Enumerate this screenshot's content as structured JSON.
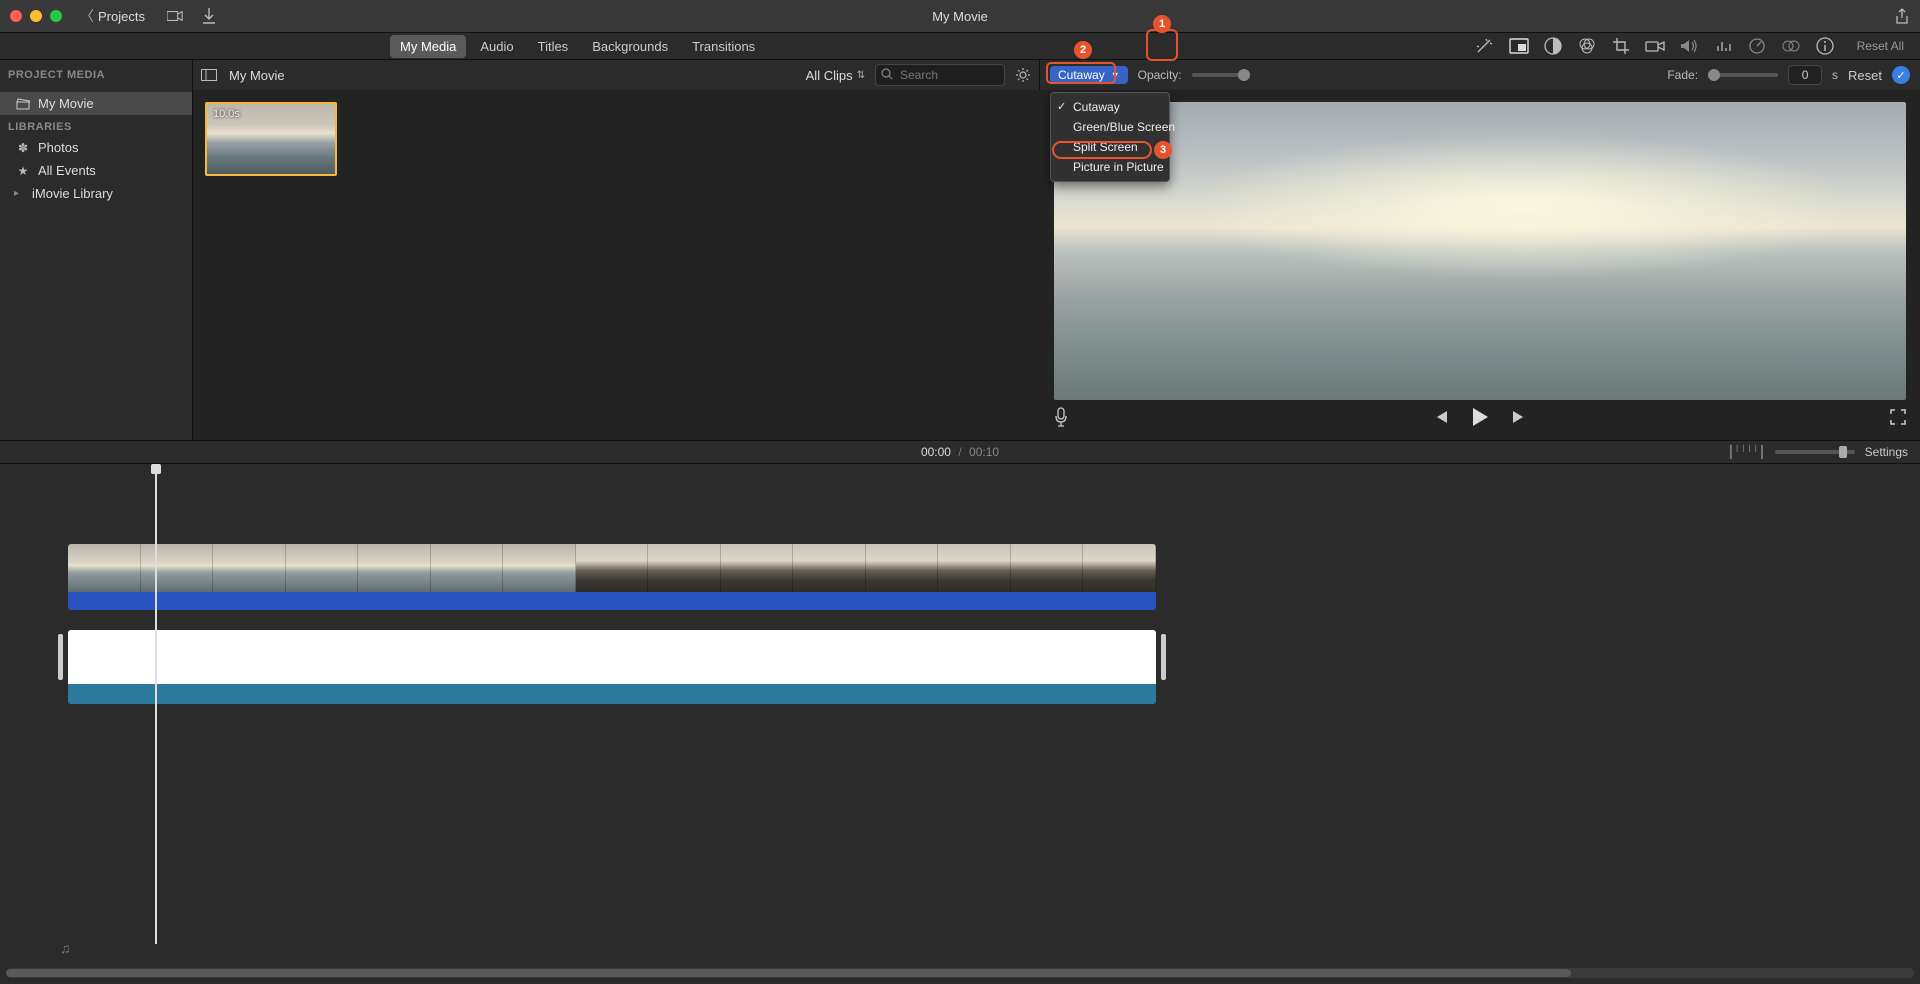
{
  "titlebar": {
    "projects_label": "Projects",
    "title": "My Movie"
  },
  "main_tabs": [
    {
      "label": "My Media",
      "active": true
    },
    {
      "label": "Audio",
      "active": false
    },
    {
      "label": "Titles",
      "active": false
    },
    {
      "label": "Backgrounds",
      "active": false
    },
    {
      "label": "Transitions",
      "active": false
    }
  ],
  "inspector": {
    "reset_all": "Reset All"
  },
  "annotations": {
    "badge1": "1",
    "badge2": "2",
    "badge3": "3"
  },
  "sidebar": {
    "header": "PROJECT MEDIA",
    "project_item": "My Movie",
    "libraries_header": "LIBRARIES",
    "items": [
      {
        "icon": "flower-icon",
        "label": "Photos"
      },
      {
        "icon": "star-icon",
        "label": "All Events"
      },
      {
        "icon": "disclosure-icon",
        "label": "iMovie Library",
        "has_disclosure": true
      }
    ]
  },
  "browser": {
    "title": "My Movie",
    "filter_label": "All Clips",
    "search_placeholder": "Search",
    "clip_duration": "10.0s"
  },
  "overlay": {
    "dropdown_value": "Cutaway",
    "opacity_label": "Opacity:",
    "fade_label": "Fade:",
    "fade_value": "0",
    "fade_unit": "s",
    "reset_label": "Reset",
    "menu": [
      {
        "label": "Cutaway",
        "checked": true
      },
      {
        "label": "Green/Blue Screen",
        "checked": false
      },
      {
        "label": "Split Screen",
        "checked": false
      },
      {
        "label": "Picture in Picture",
        "checked": false,
        "highlighted": true
      }
    ]
  },
  "timeline": {
    "current_time": "00:00",
    "separator": "/",
    "total_time": "00:10",
    "settings_label": "Settings"
  }
}
